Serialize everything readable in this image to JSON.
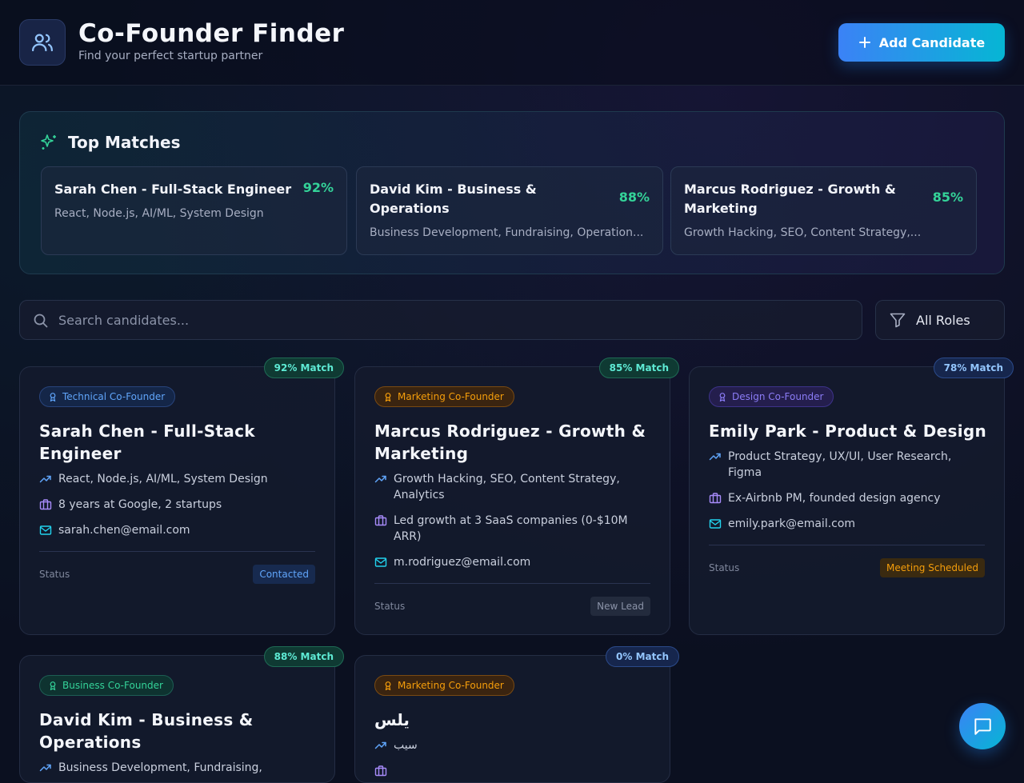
{
  "header": {
    "title": "Co-Founder Finder",
    "subtitle": "Find your perfect startup partner",
    "add_button_label": "Add Candidate"
  },
  "top_matches": {
    "title": "Top Matches",
    "items": [
      {
        "name": "Sarah Chen - Full-Stack Engineer",
        "percent": "92%",
        "skills": "React, Node.js, AI/ML, System Design"
      },
      {
        "name": "David Kim - Business & Operations",
        "percent": "88%",
        "skills": "Business Development, Fundraising, Operation..."
      },
      {
        "name": "Marcus Rodriguez - Growth & Marketing",
        "percent": "85%",
        "skills": "Growth Hacking, SEO, Content Strategy,..."
      }
    ]
  },
  "search": {
    "placeholder": "Search candidates..."
  },
  "filter": {
    "label": "All Roles"
  },
  "status_label": "Status",
  "candidates": [
    {
      "match": "92% Match",
      "role": "Technical Co-Founder",
      "name": "Sarah Chen - Full-Stack Engineer",
      "skills": "React, Node.js, AI/ML, System Design",
      "experience": "8 years at Google, 2 startups",
      "email": "sarah.chen@email.com",
      "status": "Contacted"
    },
    {
      "match": "85% Match",
      "role": "Marketing Co-Founder",
      "name": "Marcus Rodriguez - Growth & Marketing",
      "skills": "Growth Hacking, SEO, Content Strategy, Analytics",
      "experience": "Led growth at 3 SaaS companies (0-$10M ARR)",
      "email": "m.rodriguez@email.com",
      "status": "New Lead"
    },
    {
      "match": "78% Match",
      "role": "Design Co-Founder",
      "name": "Emily Park - Product & Design",
      "skills": "Product Strategy, UX/UI, User Research, Figma",
      "experience": "Ex-Airbnb PM, founded design agency",
      "email": "emily.park@email.com",
      "status": "Meeting Scheduled"
    },
    {
      "match": "88% Match",
      "role": "Business Co-Founder",
      "name": "David Kim - Business & Operations",
      "skills": "Business Development, Fundraising,"
    },
    {
      "match": "0% Match",
      "role": "Marketing Co-Founder",
      "name": "يلس",
      "skills": "سيب"
    }
  ],
  "colors": {
    "accent_start": "#3b82f6",
    "accent_end": "#06b6d4",
    "match_green": "#34d399",
    "background": "#0b1020"
  },
  "icons": {
    "logo": "users-icon",
    "sparkle": "sparkles-icon",
    "skills": "trending-up-icon",
    "experience": "briefcase-icon",
    "email": "mail-icon",
    "role": "award-icon",
    "search": "search-icon",
    "filter": "filter-icon",
    "chat": "message-square-icon"
  }
}
